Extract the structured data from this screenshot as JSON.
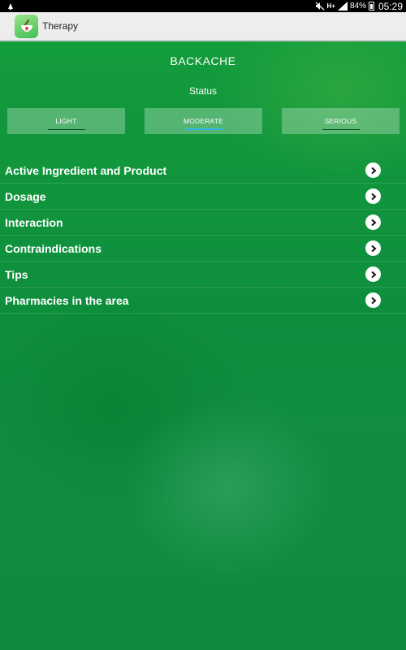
{
  "statusbar": {
    "time": "05:29",
    "battery_percent": "84%",
    "network_type": "H+",
    "icons": [
      "notification-icon",
      "mute-icon",
      "signal-icon",
      "battery-icon"
    ]
  },
  "actionbar": {
    "title": "Therapy",
    "app_icon": "mortar-pestle-icon"
  },
  "condition": {
    "title": "BACKACHE",
    "status_label": "Status"
  },
  "severity": {
    "options": [
      {
        "label": "LIGHT",
        "active": false
      },
      {
        "label": "MODERATE",
        "active": true
      },
      {
        "label": "SERIOUS",
        "active": false
      }
    ],
    "active_color": "#33b5e5"
  },
  "menu": {
    "items": [
      {
        "label": "Active Ingredient and Product",
        "icon": "chevron-right-icon"
      },
      {
        "label": "Dosage",
        "icon": "chevron-right-icon"
      },
      {
        "label": "Interaction",
        "icon": "chevron-right-icon"
      },
      {
        "label": "Contraindications",
        "icon": "chevron-right-icon"
      },
      {
        "label": "Tips",
        "icon": "chevron-right-icon"
      },
      {
        "label": "Pharmacies in the area",
        "icon": "chevron-right-icon"
      }
    ]
  },
  "colors": {
    "background": "#0e8e3d",
    "actionbar": "#ededed",
    "text": "#ffffff"
  }
}
